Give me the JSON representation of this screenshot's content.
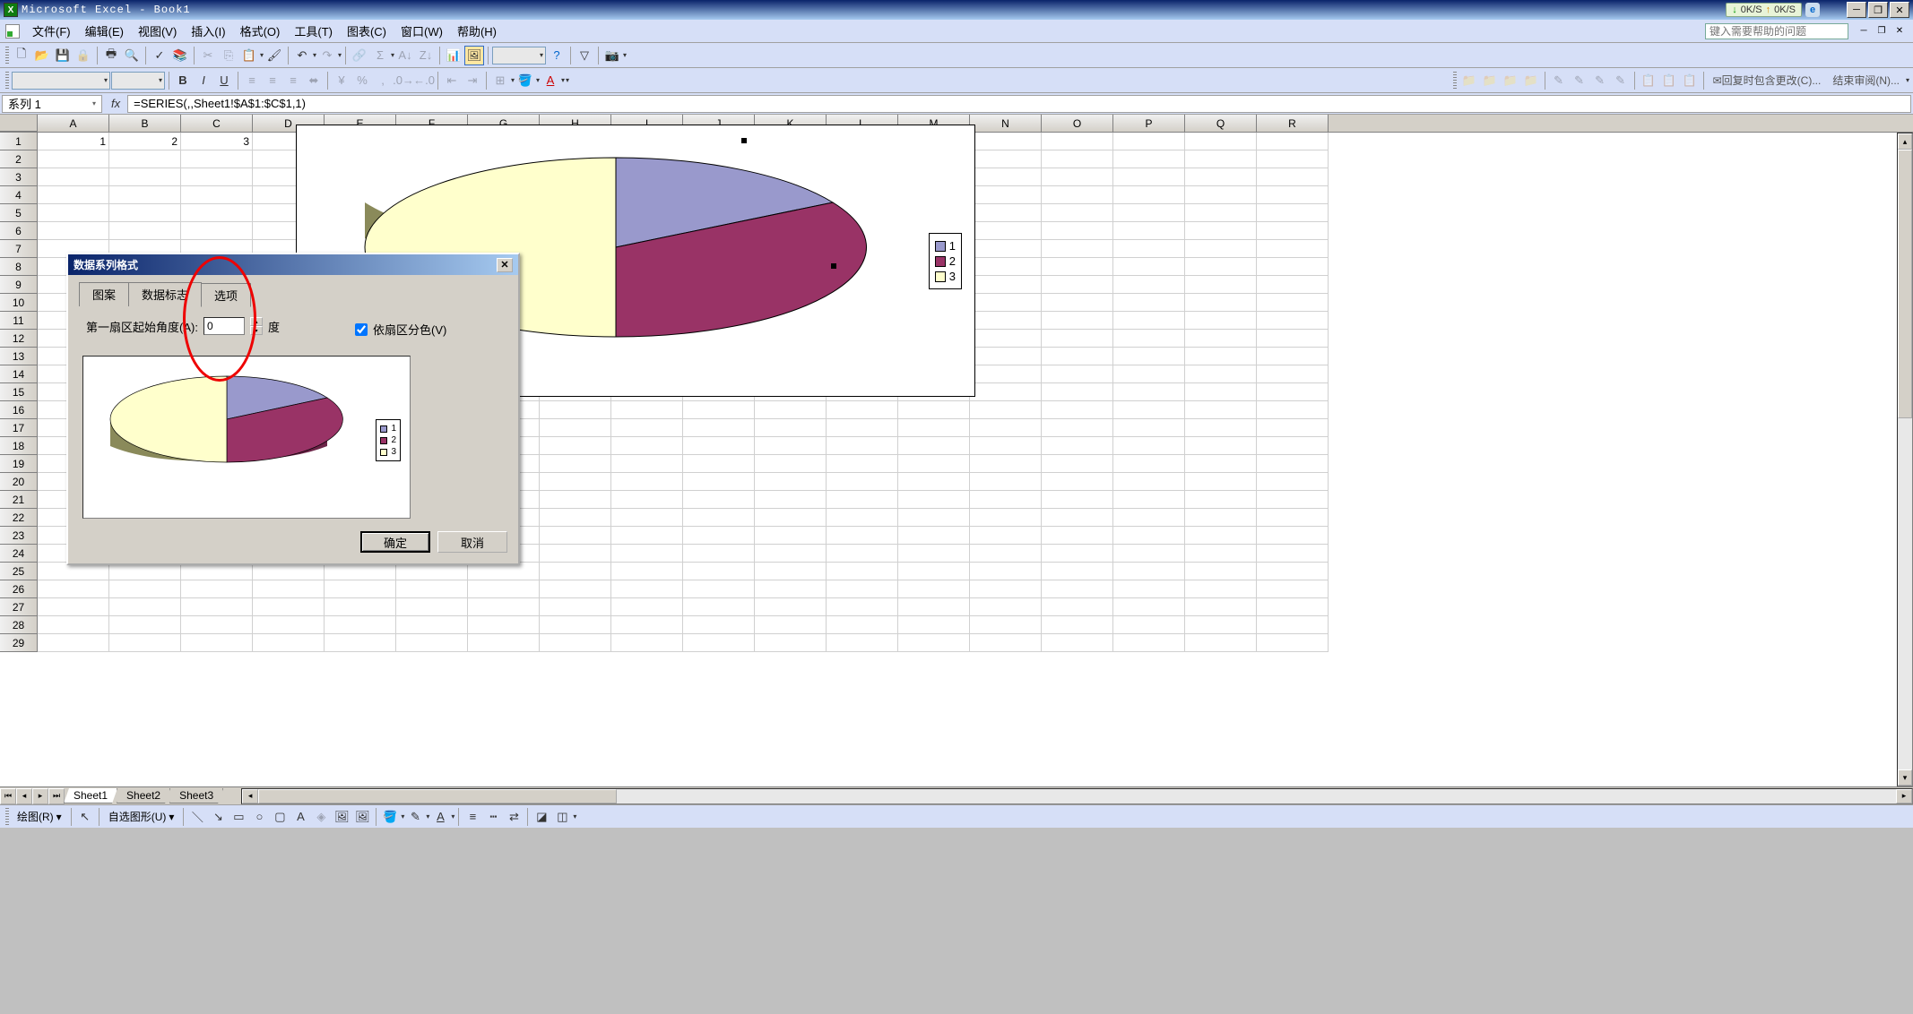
{
  "app": {
    "title": "Microsoft Excel - Book1"
  },
  "menus": [
    "文件(F)",
    "编辑(E)",
    "视图(V)",
    "插入(I)",
    "格式(O)",
    "工具(T)",
    "图表(C)",
    "窗口(W)",
    "帮助(H)"
  ],
  "help_placeholder": "键入需要帮助的问题",
  "netstat": {
    "down": "0K/S",
    "up": "0K/S"
  },
  "formula": {
    "name_box": "系列 1",
    "value": "=SERIES(,,Sheet1!$A$1:$C$1,1)"
  },
  "columns": [
    "A",
    "B",
    "C",
    "D",
    "E",
    "F",
    "G",
    "H",
    "I",
    "J",
    "K",
    "L",
    "M",
    "N",
    "O",
    "P",
    "Q",
    "R"
  ],
  "row_count": 29,
  "row1": {
    "A": "1",
    "B": "2",
    "C": "3"
  },
  "legend": {
    "items": [
      "1",
      "2",
      "3"
    ],
    "colors": [
      "#9999cc",
      "#993366",
      "#ffffcc"
    ]
  },
  "dialog": {
    "title": "数据系列格式",
    "tabs": [
      "图案",
      "数据标志",
      "选项"
    ],
    "active_tab": 2,
    "angle_label": "第一扇区起始角度(A):",
    "angle_value": "0",
    "angle_unit": "度",
    "vary_colors_label": "依扇区分色(V)",
    "vary_colors_checked": true,
    "ok": "确定",
    "cancel": "取消"
  },
  "sheets": [
    "Sheet1",
    "Sheet2",
    "Sheet3"
  ],
  "active_sheet": 0,
  "draw": {
    "label": "绘图(R)",
    "autoshapes": "自选图形(U)"
  },
  "review": {
    "reply": "回复时包含更改(C)...",
    "end": "结束审阅(N)..."
  },
  "chart_data": {
    "type": "pie",
    "categories": [
      "1",
      "2",
      "3"
    ],
    "values": [
      1,
      2,
      3
    ],
    "colors": [
      "#9999cc",
      "#993366",
      "#ffffcc"
    ],
    "title": "",
    "start_angle": 0,
    "style": "3d"
  }
}
